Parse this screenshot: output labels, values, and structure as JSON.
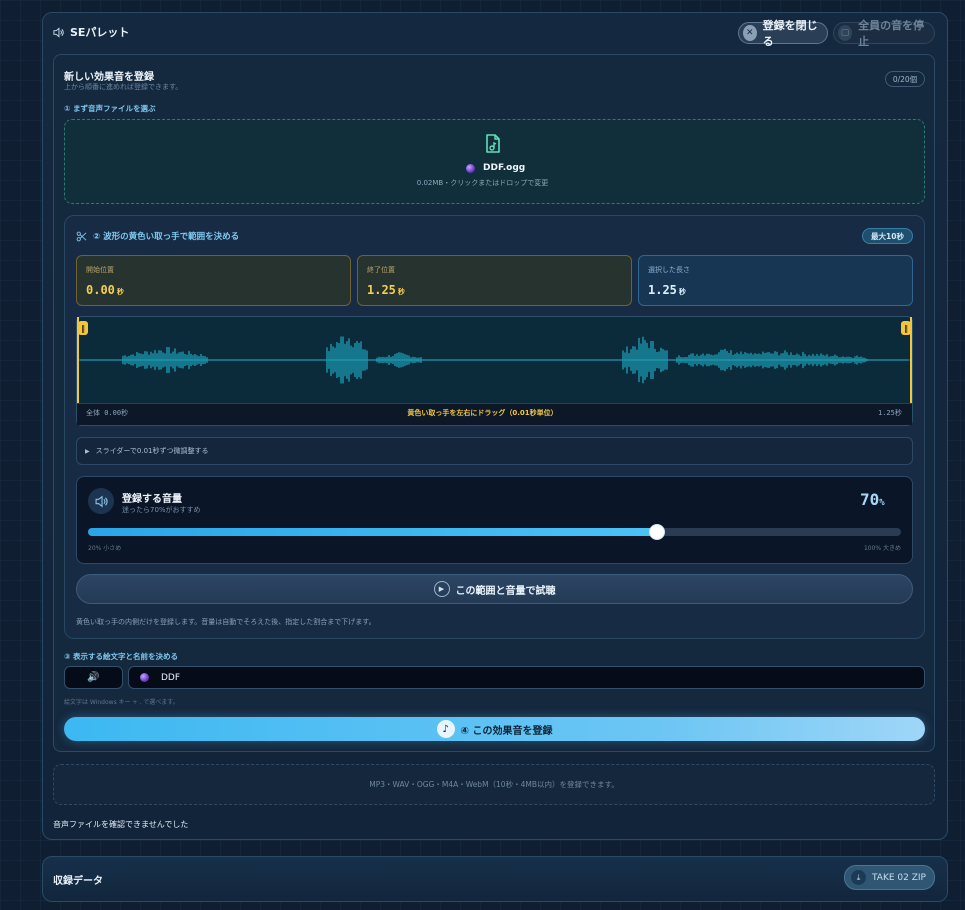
{
  "panel": {
    "title": "SEパレット",
    "close_label": "登録を閉じる",
    "stop_all_label": "全員の音を停止"
  },
  "register": {
    "title": "新しい効果音を登録",
    "subtitle": "上から順番に進めれば登録できます。",
    "count_badge": "0/20個",
    "step1_label": "① まず音声ファイルを選ぶ",
    "file": {
      "name": "DDF.ogg",
      "meta": "0.02MB・クリックまたはドロップで変更"
    },
    "step2_label": "② 波形の黄色い取っ手で範囲を決める",
    "max_badge": "最大10秒",
    "stats": {
      "start_label": "開始位置",
      "start_value": "0.00",
      "start_unit": "秒",
      "end_label": "終了位置",
      "end_value": "1.25",
      "end_unit": "秒",
      "length_label": "選択した長さ",
      "length_value": "1.25",
      "length_unit": "秒"
    },
    "waveform": {
      "total_label": "全体 0.00秒",
      "hint": "黄色い取っ手を左右にドラッグ（0.01秒単位）",
      "end_label": "1.25秒",
      "selection_start": 0.0,
      "selection_end": 1.0
    },
    "fine_tune_label": "スライダーで0.01秒ずつ微調整する",
    "volume": {
      "title": "登録する音量",
      "subtitle": "迷ったら70%がおすすめ",
      "value": "70",
      "unit": "%",
      "level": 0.7,
      "min_label": "20% 小さめ",
      "max_label": "100% 大きめ"
    },
    "preview_label": "この範囲と音量で試聴",
    "range_note": "黄色い取っ手の内側だけを登録します。音量は自動でそろえた後、指定した割合まで下げます。",
    "step3_label": "③ 表示する絵文字と名前を決める",
    "emoji_value": "🔊",
    "name_value": "DDF",
    "emoji_hint": "絵文字は Windows キー + . で選べます。",
    "submit_label": "④ この効果音を登録"
  },
  "formats_text": "MP3・WAV・OGG・M4A・WebM（10秒・4MB以内）を登録できます。",
  "error_text": "音声ファイルを確認できませんでした",
  "records": {
    "title": "収録データ",
    "zip_label": "TAKE 02 ZIP"
  },
  "colors": {
    "accent": "#3cb8f2",
    "handle": "#f4c640",
    "wave": "#22c3dc"
  }
}
